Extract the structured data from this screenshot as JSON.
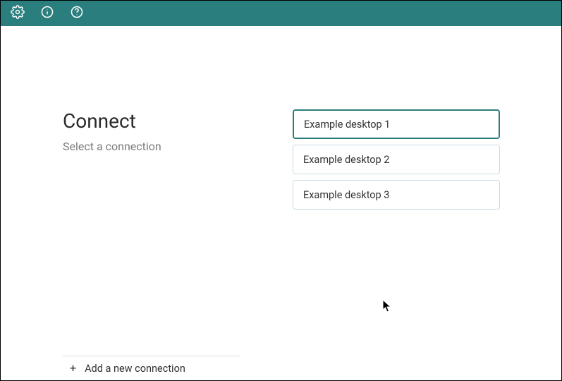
{
  "topbar": {
    "icons": {
      "settings": "gear-icon",
      "info": "info-icon",
      "help": "help-icon"
    }
  },
  "main": {
    "title": "Connect",
    "subtitle": "Select a connection"
  },
  "connections": [
    {
      "label": "Example desktop 1",
      "selected": true
    },
    {
      "label": "Example desktop 2",
      "selected": false
    },
    {
      "label": "Example desktop 3",
      "selected": false
    }
  ],
  "footer": {
    "add_label": "Add a new connection"
  },
  "colors": {
    "brand": "#2b7e7e",
    "card_border": "#c7dce3",
    "subtitle": "#7a7a7a"
  }
}
